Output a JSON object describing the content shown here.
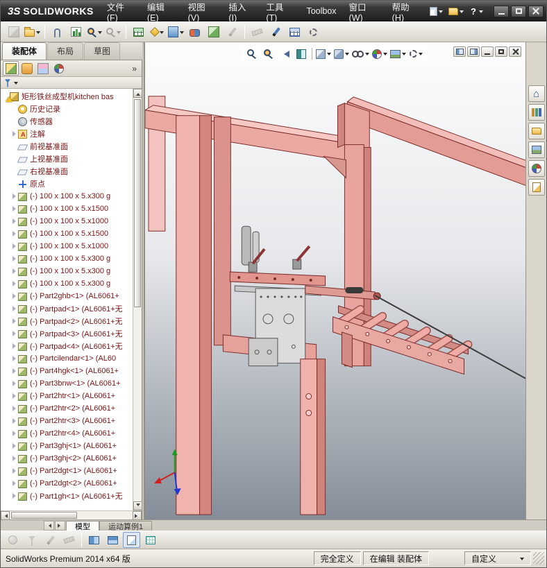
{
  "titlebar": {
    "logo_mark": "3S",
    "logo_text": "SOLIDWORKS",
    "menus": [
      "文件(F)",
      "编辑(E)",
      "视图(V)",
      "插入(I)",
      "工具(T)",
      "Toolbox",
      "窗口(W)",
      "帮助(H)"
    ],
    "quick_icons": [
      {
        "n": "new-document-icon",
        "i": "qi-page",
        "c": "car-w",
        "t": "",
        "ia": "true"
      },
      {
        "n": "open-document-icon",
        "i": "qi-folder",
        "c": "car-w",
        "t": "",
        "ia": "true"
      },
      {
        "n": "help-icon",
        "i": "qi-help",
        "c": "car-w",
        "t": "?",
        "ia": "true"
      }
    ],
    "window_controls": [
      {
        "n": "minimize-button",
        "i": "wb-min",
        "ia": "true"
      },
      {
        "n": "maximize-button",
        "i": "wb-max",
        "ia": "true"
      },
      {
        "n": "close-button",
        "i": "wb-close",
        "ia": "true"
      }
    ]
  },
  "main_toolbar": [
    {
      "w": "tb-btn dis",
      "i": "gi i-asmcube",
      "c": "",
      "n": "edit-component-icon",
      "ia": "true"
    },
    {
      "w": "tb-btn",
      "i": "i-open",
      "c": "car",
      "n": "open-document-icon",
      "ia": "true"
    },
    {
      "w": "tb-sep",
      "i": "",
      "c": "",
      "n": "toolbar-separator",
      "ia": "false"
    },
    {
      "w": "tb-btn",
      "i": "clip",
      "c": "",
      "n": "attachment-icon",
      "ia": "true"
    },
    {
      "w": "tb-btn",
      "i": "i-chart",
      "c": "",
      "n": "evaluate-chart-icon",
      "ia": "true"
    },
    {
      "w": "tb-btn",
      "i": "mag magc",
      "c": "car",
      "n": "zoom-icon",
      "ia": "true"
    },
    {
      "w": "tb-btn dis",
      "i": "mag",
      "c": "car",
      "n": "zoom-area-icon",
      "ia": "true"
    },
    {
      "w": "tb-sep",
      "i": "",
      "c": "",
      "n": "toolbar-separator",
      "ia": "false"
    },
    {
      "w": "tb-btn",
      "i": "i-grid",
      "c": "",
      "n": "design-table-icon",
      "ia": "true"
    },
    {
      "w": "tb-btn",
      "i": "i-star",
      "c": "car",
      "n": "smart-fastener-icon",
      "ia": "true"
    },
    {
      "w": "tb-btn",
      "i": "gi i-screen",
      "c": "car",
      "n": "mate-icon",
      "ia": "true"
    },
    {
      "w": "tb-btn",
      "i": "i-mate",
      "c": "",
      "n": "move-component-icon",
      "ia": "true"
    },
    {
      "w": "tb-btn",
      "i": "gi i-cubegreen",
      "c": "",
      "n": "insert-component-icon",
      "ia": "true"
    },
    {
      "w": "tb-btn dis",
      "i": "pencil pg",
      "c": "",
      "n": "sketch-icon",
      "ia": "true"
    },
    {
      "w": "tb-sep",
      "i": "",
      "c": "",
      "n": "toolbar-separator",
      "ia": "false"
    },
    {
      "w": "tb-btn dis",
      "i": "i-ruler",
      "c": "",
      "n": "measure-icon",
      "ia": "true"
    },
    {
      "w": "tb-btn",
      "i": "pencil pb",
      "c": "",
      "n": "line-tool-icon",
      "ia": "true"
    },
    {
      "w": "tb-btn",
      "i": "i-table2",
      "c": "",
      "n": "bom-table-icon",
      "ia": "true"
    },
    {
      "w": "tb-btn",
      "i": "i-gearD",
      "c": "",
      "n": "options-icon",
      "ia": "true"
    }
  ],
  "command_tabs": [
    {
      "label": "装配体",
      "cls": "ctab active"
    },
    {
      "label": "布局",
      "cls": "ctab"
    },
    {
      "label": "草图",
      "cls": "ctab"
    }
  ],
  "panel_tabs": [
    {
      "w": "ph-tab active",
      "i": "gi ih-tree",
      "n": "featuremanager-tab",
      "ia": "true"
    },
    {
      "w": "ph-tab",
      "i": "gi ih-prop",
      "n": "propertymanager-tab",
      "ia": "true"
    },
    {
      "w": "ph-tab",
      "i": "gi ih-config",
      "n": "configurationmanager-tab",
      "ia": "true"
    },
    {
      "w": "ph-tab",
      "i": "ball",
      "n": "displaymanager-tab",
      "ia": "true"
    }
  ],
  "tree": {
    "items": [
      {
        "rc": "trow",
        "ac": "t-arrow",
        "ic": "t-ic ic-root",
        "ia": "true",
        "label": "矩形铁丝成型机kitchen bas"
      },
      {
        "rc": "trow ind1",
        "ac": "t-arrow",
        "ic": "t-ic ic-history",
        "ia": "true",
        "label": "历史记录"
      },
      {
        "rc": "trow ind1",
        "ac": "t-arrow",
        "ic": "t-ic ic-sensor",
        "ia": "true",
        "label": "传感器"
      },
      {
        "rc": "trow ind1",
        "ac": "t-arrow on",
        "ic": "t-ic ic-annot",
        "ia": "true",
        "label": "注解"
      },
      {
        "rc": "trow ind1",
        "ac": "t-arrow",
        "ic": "t-ic ic-plane",
        "ia": "true",
        "label": "前视基准面"
      },
      {
        "rc": "trow ind1",
        "ac": "t-arrow",
        "ic": "t-ic ic-plane",
        "ia": "true",
        "label": "上视基准面"
      },
      {
        "rc": "trow ind1",
        "ac": "t-arrow",
        "ic": "t-ic ic-plane",
        "ia": "true",
        "label": "右视基准面"
      },
      {
        "rc": "trow ind1",
        "ac": "t-arrow",
        "ic": "t-ic ic-origin",
        "ia": "true",
        "label": "原点"
      },
      {
        "rc": "trow ind1",
        "ac": "t-arrow on",
        "ic": "t-ic ic-part",
        "ia": "true",
        "label": "(-) 100 x 100 x 5.x300 g"
      },
      {
        "rc": "trow ind1",
        "ac": "t-arrow on",
        "ic": "t-ic ic-part",
        "ia": "true",
        "label": "(-) 100 x 100 x 5.x1500"
      },
      {
        "rc": "trow ind1",
        "ac": "t-arrow on",
        "ic": "t-ic ic-part",
        "ia": "true",
        "label": "(-) 100 x 100 x 5.x1000"
      },
      {
        "rc": "trow ind1",
        "ac": "t-arrow on",
        "ic": "t-ic ic-part",
        "ia": "true",
        "label": "(-) 100 x 100 x 5.x1500"
      },
      {
        "rc": "trow ind1",
        "ac": "t-arrow on",
        "ic": "t-ic ic-part",
        "ia": "true",
        "label": "(-) 100 x 100 x 5.x1000"
      },
      {
        "rc": "trow ind1",
        "ac": "t-arrow on",
        "ic": "t-ic ic-part",
        "ia": "true",
        "label": "(-) 100 x 100 x 5.x300 g"
      },
      {
        "rc": "trow ind1",
        "ac": "t-arrow on",
        "ic": "t-ic ic-part",
        "ia": "true",
        "label": "(-) 100 x 100 x 5.x300 g"
      },
      {
        "rc": "trow ind1",
        "ac": "t-arrow on",
        "ic": "t-ic ic-part",
        "ia": "true",
        "label": "(-) 100 x 100 x 5.x300 g"
      },
      {
        "rc": "trow ind1",
        "ac": "t-arrow on",
        "ic": "t-ic ic-part",
        "ia": "true",
        "label": "(-) Part2ghb<1> (AL6061+"
      },
      {
        "rc": "trow ind1",
        "ac": "t-arrow on",
        "ic": "t-ic ic-part",
        "ia": "true",
        "label": "(-) Partpad<1> (AL6061+无"
      },
      {
        "rc": "trow ind1",
        "ac": "t-arrow on",
        "ic": "t-ic ic-part",
        "ia": "true",
        "label": "(-) Partpad<2> (AL6061+无"
      },
      {
        "rc": "trow ind1",
        "ac": "t-arrow on",
        "ic": "t-ic ic-part",
        "ia": "true",
        "label": "(-) Partpad<3> (AL6061+无"
      },
      {
        "rc": "trow ind1",
        "ac": "t-arrow on",
        "ic": "t-ic ic-part",
        "ia": "true",
        "label": "(-) Partpad<4> (AL6061+无"
      },
      {
        "rc": "trow ind1",
        "ac": "t-arrow on",
        "ic": "t-ic ic-part",
        "ia": "true",
        "label": "(-) Partcilendar<1> (AL60"
      },
      {
        "rc": "trow ind1",
        "ac": "t-arrow on",
        "ic": "t-ic ic-part",
        "ia": "true",
        "label": "(-) Part4hgk<1> (AL6061+"
      },
      {
        "rc": "trow ind1",
        "ac": "t-arrow on",
        "ic": "t-ic ic-part",
        "ia": "true",
        "label": "(-) Part3bnw<1> (AL6061+"
      },
      {
        "rc": "trow ind1",
        "ac": "t-arrow on",
        "ic": "t-ic ic-part",
        "ia": "true",
        "label": "(-) Part2htr<1> (AL6061+"
      },
      {
        "rc": "trow ind1",
        "ac": "t-arrow on",
        "ic": "t-ic ic-part",
        "ia": "true",
        "label": "(-) Part2htr<2> (AL6061+"
      },
      {
        "rc": "trow ind1",
        "ac": "t-arrow on",
        "ic": "t-ic ic-part",
        "ia": "true",
        "label": "(-) Part2htr<3> (AL6061+"
      },
      {
        "rc": "trow ind1",
        "ac": "t-arrow on",
        "ic": "t-ic ic-part",
        "ia": "true",
        "label": "(-) Part2htr<4> (AL6061+"
      },
      {
        "rc": "trow ind1",
        "ac": "t-arrow on",
        "ic": "t-ic ic-part",
        "ia": "true",
        "label": "(-) Part3ghj<1> (AL6061+"
      },
      {
        "rc": "trow ind1",
        "ac": "t-arrow on",
        "ic": "t-ic ic-part",
        "ia": "true",
        "label": "(-) Part3ghj<2> (AL6061+"
      },
      {
        "rc": "trow ind1",
        "ac": "t-arrow on",
        "ic": "t-ic ic-part",
        "ia": "true",
        "label": "(-) Part2dgt<1> (AL6061+"
      },
      {
        "rc": "trow ind1",
        "ac": "t-arrow on",
        "ic": "t-ic ic-part",
        "ia": "true",
        "label": "(-) Part2dgt<2> (AL6061+"
      },
      {
        "rc": "trow ind1",
        "ac": "t-arrow on",
        "ic": "t-ic ic-part",
        "ia": "true",
        "label": "(-) Part1gh<1> (AL6061+无"
      }
    ]
  },
  "headsup": [
    {
      "w": "hz-btn",
      "i": "mag",
      "c": "",
      "n": "zoom-to-fit-icon",
      "ia": "true"
    },
    {
      "w": "hz-btn",
      "i": "mag magc",
      "c": "",
      "n": "zoom-to-area-icon",
      "ia": "true"
    },
    {
      "w": "hz-btn",
      "i": "hz-prev",
      "c": "",
      "n": "previous-view-icon",
      "ia": "true"
    },
    {
      "w": "hz-btn",
      "i": "hz-sect",
      "c": "",
      "n": "section-view-icon",
      "ia": "true"
    },
    {
      "w": "hz-sepd",
      "i": "",
      "c": "",
      "n": "headsup-separator",
      "ia": "false"
    },
    {
      "w": "hz-btn",
      "i": "hz-cube",
      "c": "car",
      "n": "view-orientation-icon",
      "ia": "true"
    },
    {
      "w": "hz-btn",
      "i": "hz-style",
      "c": "car",
      "n": "display-style-icon",
      "ia": "true"
    },
    {
      "w": "hz-btn",
      "i": "glasses",
      "c": "car",
      "n": "hide-show-items-icon",
      "ia": "true"
    },
    {
      "w": "hz-btn",
      "i": "ball",
      "c": "car",
      "n": "edit-appearance-icon",
      "ia": "true"
    },
    {
      "w": "hz-btn",
      "i": "hz-scene",
      "c": "car",
      "n": "apply-scene-icon",
      "ia": "true"
    },
    {
      "w": "hz-btn",
      "i": "hz-set",
      "c": "car",
      "n": "view-settings-icon",
      "ia": "true"
    }
  ],
  "childwin": [
    {
      "w": "cw-btn",
      "i": "cw-p1",
      "n": "previous-window-icon",
      "ia": "true"
    },
    {
      "w": "cw-btn",
      "i": "cw-p2",
      "n": "next-window-icon",
      "ia": "true"
    },
    {
      "w": "cw-btn",
      "i": "wg-min",
      "n": "minimize-document-icon",
      "ia": "true"
    },
    {
      "w": "cw-btn",
      "i": "wg-rest",
      "n": "restore-document-icon",
      "ia": "true"
    },
    {
      "w": "cw-btn",
      "i": "wg-x",
      "n": "close-document-icon",
      "ia": "true"
    }
  ],
  "taskpane": [
    {
      "i": "tp-home",
      "n": "solidworks-resources-icon",
      "ia": "true"
    },
    {
      "i": "tp-lib",
      "n": "design-library-icon",
      "ia": "true"
    },
    {
      "i": "tp-files",
      "n": "file-explorer-icon",
      "ia": "true"
    },
    {
      "i": "tp-palette",
      "n": "view-palette-icon",
      "ia": "true"
    },
    {
      "i": "ball",
      "n": "appearances-scenes-icon",
      "ia": "true"
    },
    {
      "i": "tp-custom",
      "n": "custom-properties-icon",
      "ia": "true"
    }
  ],
  "model_tabs": [
    {
      "label": "模型",
      "cls": "mtab active"
    },
    {
      "label": "运动算例1",
      "cls": "mtab"
    }
  ],
  "bottom_toolbar": [
    {
      "w": "tb-btn dis",
      "i": "i-ballg",
      "c": "",
      "n": "mass-properties-icon",
      "ia": "true"
    },
    {
      "w": "tb-btn dis",
      "i": "funnel fg",
      "c": "",
      "n": "selection-filter-icon",
      "ia": "true"
    },
    {
      "w": "tb-btn dis",
      "i": "pencil pg",
      "c": "",
      "n": "annotate-icon",
      "ia": "true"
    },
    {
      "w": "tb-btn dis",
      "i": "i-ruler",
      "c": "",
      "n": "measure-icon",
      "ia": "true"
    },
    {
      "w": "tb-sep",
      "i": "",
      "c": "",
      "n": "toolbar-separator",
      "ia": "false"
    },
    {
      "w": "tb-btn",
      "i": "i-panes",
      "c": "",
      "n": "viewport-split-icon",
      "ia": "true"
    },
    {
      "w": "tb-btn",
      "i": "i-panes2",
      "c": "",
      "n": "viewport-horizontal-icon",
      "ia": "true"
    },
    {
      "w": "tb-btn sel",
      "i": "i-pagewb",
      "c": "",
      "n": "single-view-icon",
      "ia": "true"
    },
    {
      "w": "tb-btn",
      "i": "i-gridt",
      "c": "",
      "n": "draft-grid-icon",
      "ia": "true"
    }
  ],
  "statusbar": {
    "left": "SolidWorks Premium 2014 x64 版",
    "define_state": "完全定义",
    "editing_state": "在编辑 装配体",
    "custom_label": "自定义"
  },
  "accent_colors": {
    "model_pink": "#f0b3ae",
    "model_edge": "#7e2f2b",
    "tree_text": "#7a1414",
    "titlebar_dark": "#1c1c1c"
  }
}
